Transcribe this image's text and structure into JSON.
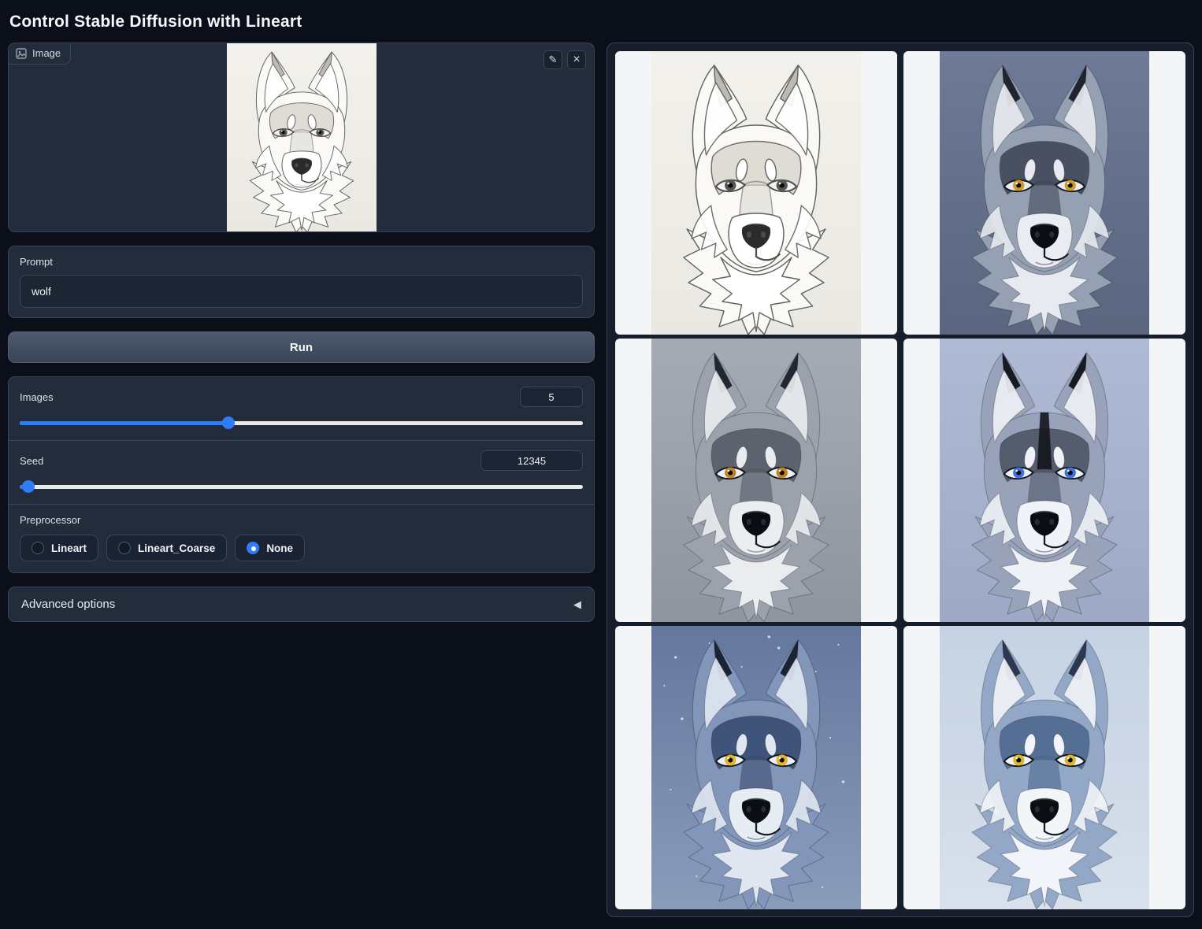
{
  "page": {
    "title": "Control Stable Diffusion with Lineart"
  },
  "colors": {
    "page_bg": "#0b0f19",
    "panel_bg": "#232c3b",
    "border": "#3a4558",
    "accent_blue": "#2e7cf6",
    "gallery_cell_bg": "#f4f5f6"
  },
  "input_image": {
    "label": "Image",
    "icon": "image-icon",
    "buttons": {
      "edit": "✎",
      "clear": "×"
    },
    "alt": "pencil lineart sketch of a wolf head",
    "palette": {
      "bgTop": "#f3f1ec",
      "bgBottom": "#eae8e2",
      "furMid": "#faf9f6",
      "furDark": "#dcdad3",
      "furLight": "#ffffff",
      "muzzle": "#ffffff",
      "eye": "#565656",
      "eyeWhite": "#f4f3ef",
      "earTip": "#bcbab2",
      "stroke": "#63635f",
      "strokeWidth": 1.4,
      "noseFill": "#2b2b2b",
      "nostril": "#4a4a4a",
      "lineDark": "#4e4e4a"
    }
  },
  "prompt": {
    "label": "Prompt",
    "value": "wolf"
  },
  "run_button": {
    "label": "Run"
  },
  "sliders": {
    "images": {
      "label": "Images",
      "value": "5",
      "fill_percent": 37
    },
    "seed": {
      "label": "Seed",
      "value": "12345",
      "fill_percent": 1.5
    }
  },
  "preprocessor": {
    "label": "Preprocessor",
    "options": [
      {
        "label": "Lineart",
        "selected": false
      },
      {
        "label": "Lineart_Coarse",
        "selected": false
      },
      {
        "label": "None",
        "selected": true
      }
    ]
  },
  "advanced": {
    "label": "Advanced options",
    "collapse_icon": "◀"
  },
  "gallery": {
    "items": [
      {
        "alt": "pencil lineart wolf sketch on paper",
        "palette": {
          "bgTop": "#f3f1ec",
          "bgBottom": "#eae8e2",
          "furMid": "#faf9f6",
          "furDark": "#dcdad3",
          "furLight": "#ffffff",
          "muzzle": "#ffffff",
          "eye": "#565656",
          "eyeWhite": "#f4f3ef",
          "earTip": "#bcbab2",
          "stroke": "#63635f",
          "strokeWidth": 1.4,
          "noseFill": "#2b2b2b",
          "nostril": "#4a4a4a",
          "lineDark": "#4e4e4a"
        }
      },
      {
        "alt": "digital gray wolf with amber eyes on slate blue background",
        "palette": {
          "bgTop": "#6e7a96",
          "bgBottom": "#5a667f",
          "furMid": "#95a0b2",
          "furDark": "#424a5c",
          "furLight": "#e7eaef",
          "muzzle": "#e9ecf0",
          "eye": "#cf9a26",
          "eyeWhite": "#e9edf3",
          "earTip": "#20242e",
          "stroke": "rgba(15,20,30,0.3)",
          "strokeWidth": 1
        }
      },
      {
        "alt": "gray wolf with orange eyes on blurred gray background",
        "palette": {
          "bgTop": "#a6abb3",
          "bgBottom": "#8f959f",
          "furMid": "#9ba2ac",
          "furDark": "#575d69",
          "furLight": "#eaecef",
          "muzzle": "#ecedf0",
          "eye": "#c28226",
          "eyeWhite": "#eef0f3",
          "earTip": "#232730",
          "stroke": "rgba(20,24,32,0.3)",
          "strokeWidth": 1
        }
      },
      {
        "alt": "husky-like wolf with blue eyes and dark forehead stripe on periwinkle background",
        "palette": {
          "bgTop": "#b0bad4",
          "bgBottom": "#9da9c6",
          "furMid": "#98a3ba",
          "furDark": "#4f5668",
          "furLight": "#eef1f6",
          "muzzle": "#f0f3f7",
          "eye": "#3e71da",
          "eyeWhite": "#eef2f8",
          "earTip": "#171a22",
          "stroke": "rgba(15,20,30,0.3)",
          "strokeWidth": 1,
          "centerStripe": "#14161d"
        }
      },
      {
        "alt": "blue-toned wolf with yellow eyes on starry night-blue background",
        "palette": {
          "bgTop": "#64779e",
          "bgBottom": "#8a9cba",
          "furMid": "#8296b9",
          "furDark": "#3b4e73",
          "furLight": "#e0e7f1",
          "muzzle": "#e6ecf4",
          "eye": "#e3b52f",
          "eyeWhite": "#eaf0f8",
          "earTip": "#1c2433",
          "stroke": "rgba(15,20,40,0.3)",
          "strokeWidth": 1,
          "stars": true
        }
      },
      {
        "alt": "light blue wolf with yellow eyes on pale blue background",
        "palette": {
          "bgTop": "#c6d2e3",
          "bgBottom": "#d8e1ec",
          "furMid": "#93a8c6",
          "furDark": "#506a90",
          "furLight": "#f1f4f8",
          "muzzle": "#f3f6f9",
          "eye": "#d9b72f",
          "eyeWhite": "#f2f5f9",
          "earTip": "#2a3950",
          "stroke": "rgba(20,30,50,0.3)",
          "strokeWidth": 1
        }
      }
    ]
  }
}
